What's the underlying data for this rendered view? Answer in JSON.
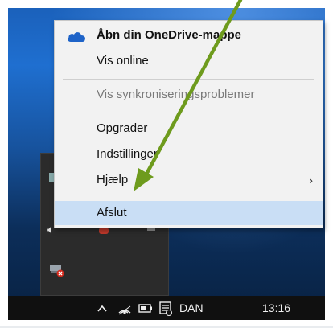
{
  "menu": {
    "items": [
      {
        "label": "Åbn din OneDrive-mappe",
        "bold": true,
        "icon": "onedrive-cloud-icon"
      },
      {
        "label": "Vis online"
      },
      {
        "label": "Vis synkroniseringsproblemer",
        "disabled": true
      },
      {
        "label": "Opgrader"
      },
      {
        "label": "Indstillinger"
      },
      {
        "label": "Hjælp",
        "submenu": true
      },
      {
        "label": "Afslut",
        "highlighted": true
      }
    ],
    "submenu_glyph": "›"
  },
  "taskbar": {
    "language": "DAN",
    "time": "13:16",
    "icons": [
      "chevron-up-icon",
      "wifi-icon",
      "battery-icon",
      "notification-icon"
    ]
  },
  "colors": {
    "highlight": "#c9def5",
    "arrow": "#6e9b1d",
    "onedrive_blue": "#1e63c8",
    "taskbar": "#101010"
  }
}
